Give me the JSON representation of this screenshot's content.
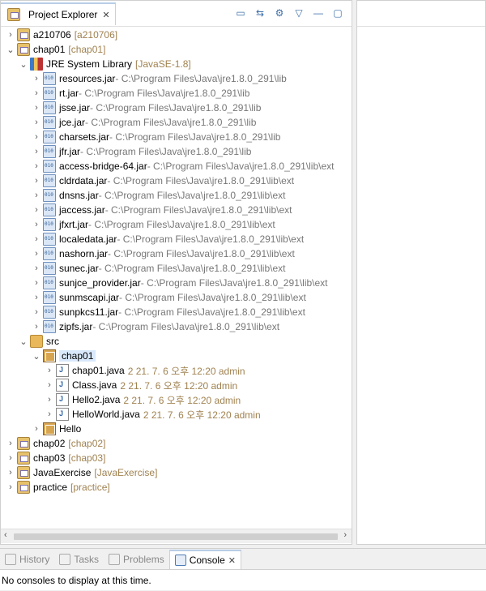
{
  "explorer": {
    "tab_title": "Project Explorer",
    "tab_close": "✕",
    "toolbar": [
      "▭",
      "⇆",
      "⚙",
      "▽",
      "—",
      "▢"
    ]
  },
  "tree": [
    {
      "depth": 0,
      "toggle": "›",
      "icon": "project",
      "label": "a210706",
      "deco": "[a210706]"
    },
    {
      "depth": 0,
      "toggle": "⌄",
      "icon": "project",
      "label": "chap01",
      "deco": "[chap01]"
    },
    {
      "depth": 1,
      "toggle": "⌄",
      "icon": "library",
      "label": "JRE System Library",
      "deco": "[JavaSE-1.8]"
    },
    {
      "depth": 2,
      "toggle": "›",
      "icon": "jar",
      "label": "resources.jar",
      "path": " - C:\\Program Files\\Java\\jre1.8.0_291\\lib"
    },
    {
      "depth": 2,
      "toggle": "›",
      "icon": "jar",
      "label": "rt.jar",
      "path": " - C:\\Program Files\\Java\\jre1.8.0_291\\lib"
    },
    {
      "depth": 2,
      "toggle": "›",
      "icon": "jar",
      "label": "jsse.jar",
      "path": " - C:\\Program Files\\Java\\jre1.8.0_291\\lib"
    },
    {
      "depth": 2,
      "toggle": "›",
      "icon": "jar",
      "label": "jce.jar",
      "path": " - C:\\Program Files\\Java\\jre1.8.0_291\\lib"
    },
    {
      "depth": 2,
      "toggle": "›",
      "icon": "jar",
      "label": "charsets.jar",
      "path": " - C:\\Program Files\\Java\\jre1.8.0_291\\lib"
    },
    {
      "depth": 2,
      "toggle": "›",
      "icon": "jar",
      "label": "jfr.jar",
      "path": " - C:\\Program Files\\Java\\jre1.8.0_291\\lib"
    },
    {
      "depth": 2,
      "toggle": "›",
      "icon": "jar",
      "label": "access-bridge-64.jar",
      "path": " - C:\\Program Files\\Java\\jre1.8.0_291\\lib\\ext"
    },
    {
      "depth": 2,
      "toggle": "›",
      "icon": "jar",
      "label": "cldrdata.jar",
      "path": " - C:\\Program Files\\Java\\jre1.8.0_291\\lib\\ext"
    },
    {
      "depth": 2,
      "toggle": "›",
      "icon": "jar",
      "label": "dnsns.jar",
      "path": " - C:\\Program Files\\Java\\jre1.8.0_291\\lib\\ext"
    },
    {
      "depth": 2,
      "toggle": "›",
      "icon": "jar",
      "label": "jaccess.jar",
      "path": " - C:\\Program Files\\Java\\jre1.8.0_291\\lib\\ext"
    },
    {
      "depth": 2,
      "toggle": "›",
      "icon": "jar",
      "label": "jfxrt.jar",
      "path": " - C:\\Program Files\\Java\\jre1.8.0_291\\lib\\ext"
    },
    {
      "depth": 2,
      "toggle": "›",
      "icon": "jar",
      "label": "localedata.jar",
      "path": " - C:\\Program Files\\Java\\jre1.8.0_291\\lib\\ext"
    },
    {
      "depth": 2,
      "toggle": "›",
      "icon": "jar",
      "label": "nashorn.jar",
      "path": " - C:\\Program Files\\Java\\jre1.8.0_291\\lib\\ext"
    },
    {
      "depth": 2,
      "toggle": "›",
      "icon": "jar",
      "label": "sunec.jar",
      "path": " - C:\\Program Files\\Java\\jre1.8.0_291\\lib\\ext"
    },
    {
      "depth": 2,
      "toggle": "›",
      "icon": "jar",
      "label": "sunjce_provider.jar",
      "path": " - C:\\Program Files\\Java\\jre1.8.0_291\\lib\\ext"
    },
    {
      "depth": 2,
      "toggle": "›",
      "icon": "jar",
      "label": "sunmscapi.jar",
      "path": " - C:\\Program Files\\Java\\jre1.8.0_291\\lib\\ext"
    },
    {
      "depth": 2,
      "toggle": "›",
      "icon": "jar",
      "label": "sunpkcs11.jar",
      "path": " - C:\\Program Files\\Java\\jre1.8.0_291\\lib\\ext"
    },
    {
      "depth": 2,
      "toggle": "›",
      "icon": "jar",
      "label": "zipfs.jar",
      "path": " - C:\\Program Files\\Java\\jre1.8.0_291\\lib\\ext"
    },
    {
      "depth": 1,
      "toggle": "⌄",
      "icon": "srcfolder",
      "label": "src"
    },
    {
      "depth": 2,
      "toggle": "⌄",
      "icon": "package",
      "label": "chap01",
      "selected": true
    },
    {
      "depth": 3,
      "toggle": "›",
      "icon": "java",
      "label": "chap01.java",
      "deco": "2  21. 7. 6 오후 12:20  admin"
    },
    {
      "depth": 3,
      "toggle": "›",
      "icon": "java",
      "label": "Class.java",
      "deco": "2  21. 7. 6 오후 12:20  admin"
    },
    {
      "depth": 3,
      "toggle": "›",
      "icon": "java",
      "label": "Hello2.java",
      "deco": "2  21. 7. 6 오후 12:20  admin"
    },
    {
      "depth": 3,
      "toggle": "›",
      "icon": "java",
      "label": "HelloWorld.java",
      "deco": "2  21. 7. 6 오후 12:20  admin"
    },
    {
      "depth": 2,
      "toggle": "›",
      "icon": "package",
      "label": "Hello"
    },
    {
      "depth": 0,
      "toggle": "›",
      "icon": "project",
      "label": "chap02",
      "deco": "[chap02]"
    },
    {
      "depth": 0,
      "toggle": "›",
      "icon": "project",
      "label": "chap03",
      "deco": "[chap03]"
    },
    {
      "depth": 0,
      "toggle": "›",
      "icon": "project",
      "label": "JavaExercise",
      "deco": "[JavaExercise]"
    },
    {
      "depth": 0,
      "toggle": "›",
      "icon": "project",
      "label": "practice",
      "deco": "[practice]"
    }
  ],
  "scrollbar": {
    "left": "‹",
    "right": "›"
  },
  "bottom": {
    "tabs": [
      {
        "label": "History",
        "active": false
      },
      {
        "label": "Tasks",
        "active": false
      },
      {
        "label": "Problems",
        "active": false
      },
      {
        "label": "Console",
        "active": true,
        "close": "✕"
      }
    ],
    "console_message": "No consoles to display at this time."
  }
}
